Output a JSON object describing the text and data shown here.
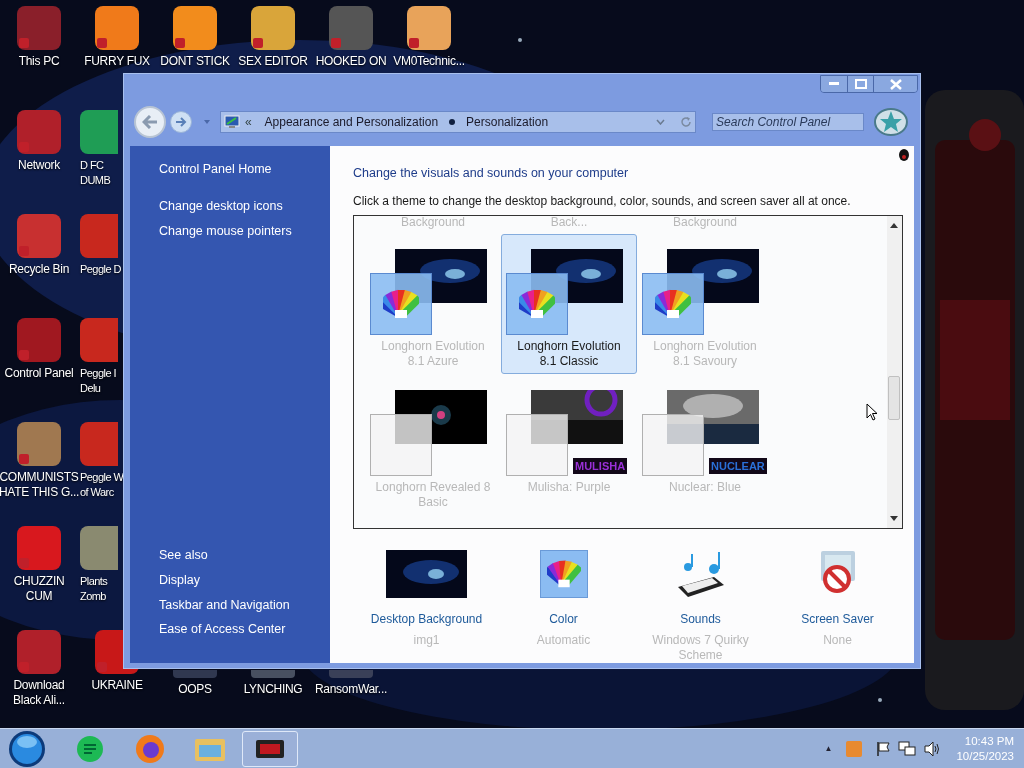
{
  "desktop": {
    "icon_rows": [
      [
        {
          "label": "This PC",
          "color": "#8a1f2a"
        },
        {
          "label": "FURRY FUX",
          "color": "#f07a1a"
        },
        {
          "label": "DONT STICK",
          "color": "#f28c1c"
        },
        {
          "label": "SEX EDITOR",
          "color": "#d9a53a"
        },
        {
          "label": "HOOKED ON",
          "color": "#555555"
        },
        {
          "label": "VM0Technic...",
          "color": "#e8a35a"
        }
      ],
      [
        {
          "label": "Network",
          "color": "#b0202a"
        },
        {
          "label": "D FC\nDUMB",
          "color": "#1f9d55"
        }
      ],
      [
        {
          "label": "Recycle Bin",
          "color": "#c83030"
        },
        {
          "label": "Peggle D",
          "color": "#c8281e"
        }
      ],
      [
        {
          "label": "Control Panel",
          "color": "#a01820"
        },
        {
          "label": "Peggle I\nDelu",
          "color": "#c8281e"
        }
      ],
      [
        {
          "label": "COMMUNISTS\nHATE THIS G...",
          "color": "#a07850"
        },
        {
          "label": "Peggle W\nof Warc",
          "color": "#c8281e"
        }
      ],
      [
        {
          "label": "CHUZZIN\nCUM",
          "color": "#d8181e"
        },
        {
          "label": "Plants\nZomb",
          "color": "#8a8a70"
        }
      ],
      [
        {
          "label": "Download\nBlack Ali...",
          "color": "#b0202a"
        },
        {
          "label": "UKRAINE",
          "color": "#c81818"
        },
        {
          "label": "OOPS",
          "color": "#303850"
        },
        {
          "label": "LYNCHING",
          "color": "#485060"
        },
        {
          "label": "RansomWar...",
          "color": "#3a4058"
        }
      ]
    ]
  },
  "window": {
    "address": {
      "parent": "Appearance and Personalization",
      "current": "Personalization",
      "overflow": "«"
    },
    "search": {
      "placeholder": "Search Control Panel"
    },
    "sidebar": {
      "links": [
        "Control Panel Home",
        "Change desktop icons",
        "Change mouse pointers"
      ],
      "see_also": {
        "heading": "See also",
        "links": [
          "Display",
          "Taskbar and Navigation",
          "Ease of Access Center"
        ]
      }
    },
    "content": {
      "title": "Change the visuals and sounds on your computer",
      "description": "Click a theme to change the desktop background, color, sounds, and screen saver all at once.",
      "cut_labels": [
        "Background",
        "Back...",
        "Background"
      ],
      "themes": [
        {
          "name": "Longhorn Evolution\n8.1 Azure",
          "kind": "color",
          "selected": false
        },
        {
          "name": "Longhorn Evolution\n8.1 Classic",
          "kind": "color",
          "selected": true
        },
        {
          "name": "Longhorn Evolution\n8.1 Savoury",
          "kind": "color",
          "selected": false
        },
        {
          "name": "Longhorn Revealed 8\nBasic",
          "kind": "plain",
          "selected": false
        },
        {
          "name": "Mulisha: Purple",
          "kind": "plain",
          "badge": "MULISHA",
          "selected": false
        },
        {
          "name": "Nuclear: Blue",
          "kind": "plain",
          "badge": "NUCLEAR",
          "selected": false
        }
      ],
      "settings": [
        {
          "kind": "background",
          "title": "Desktop Background",
          "value": "img1"
        },
        {
          "kind": "color",
          "title": "Color",
          "value": "Automatic"
        },
        {
          "kind": "sounds",
          "title": "Sounds",
          "value": "Windows 7 Quirky\nScheme"
        },
        {
          "kind": "screensaver",
          "title": "Screen Saver",
          "value": "None"
        }
      ]
    }
  },
  "taskbar": {
    "apps": [
      {
        "kind": "sheets",
        "selected": false
      },
      {
        "kind": "browser",
        "selected": false
      },
      {
        "kind": "folder",
        "selected": false
      },
      {
        "kind": "panel",
        "selected": true
      }
    ],
    "tray_caret": "▲",
    "time": "10:43 PM",
    "date": "10/25/2023"
  }
}
